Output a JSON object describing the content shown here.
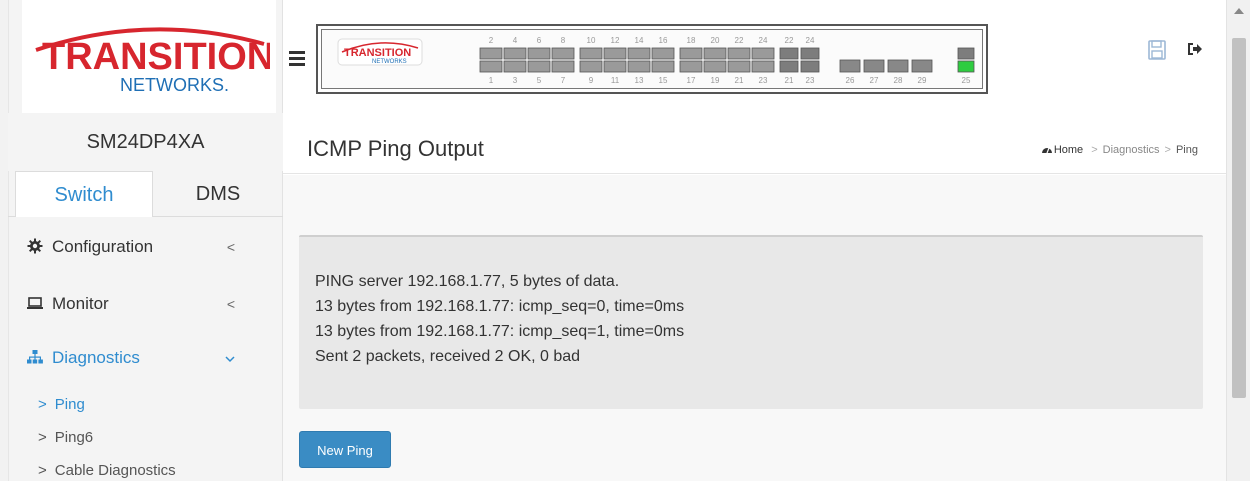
{
  "brand": {
    "logo_line1": "TRANSITION",
    "logo_line2": "NETWORKS.",
    "model": "SM24DP4XA",
    "panel_logo_line1": "TRANSITION",
    "panel_logo_line2": "NETWORKS",
    "accent": "#2f8ccf",
    "logo_red": "#d7262e",
    "logo_blue": "#1f6fb5"
  },
  "panel": {
    "top_port_labels": [
      "2",
      "4",
      "6",
      "8",
      "10",
      "12",
      "14",
      "16",
      "18",
      "20",
      "22",
      "24",
      "22",
      "24"
    ],
    "bottom_port_labels": [
      "1",
      "3",
      "5",
      "7",
      "9",
      "11",
      "13",
      "15",
      "17",
      "19",
      "21",
      "23",
      "21",
      "23",
      "26",
      "27",
      "28",
      "29",
      "25"
    ]
  },
  "sidebar": {
    "tabs": [
      {
        "label": "Switch",
        "active": true
      },
      {
        "label": "DMS",
        "active": false
      }
    ],
    "items": [
      {
        "label": "Configuration",
        "icon": "gear-icon",
        "chevron": "<"
      },
      {
        "label": "Monitor",
        "icon": "monitor-icon",
        "chevron": "<"
      },
      {
        "label": "Diagnostics",
        "icon": "sitemap-icon",
        "chevron": "⌵",
        "open": true
      }
    ],
    "subitems": [
      {
        "label": "Ping",
        "active": true
      },
      {
        "label": "Ping6",
        "active": false
      },
      {
        "label": "Cable Diagnostics",
        "active": false
      }
    ],
    "caret": ">"
  },
  "header": {
    "title": "ICMP Ping Output",
    "breadcrumb": {
      "home": "Home",
      "sep": ">",
      "section": "Diagnostics",
      "current": "Ping"
    }
  },
  "output": {
    "lines": [
      "PING server 192.168.1.77, 5 bytes of data.",
      "13 bytes from 192.168.1.77: icmp_seq=0, time=0ms",
      "13 bytes from 192.168.1.77: icmp_seq=1, time=0ms",
      "Sent 2 packets, received 2 OK, 0 bad"
    ]
  },
  "actions": {
    "new_ping": "New Ping"
  }
}
